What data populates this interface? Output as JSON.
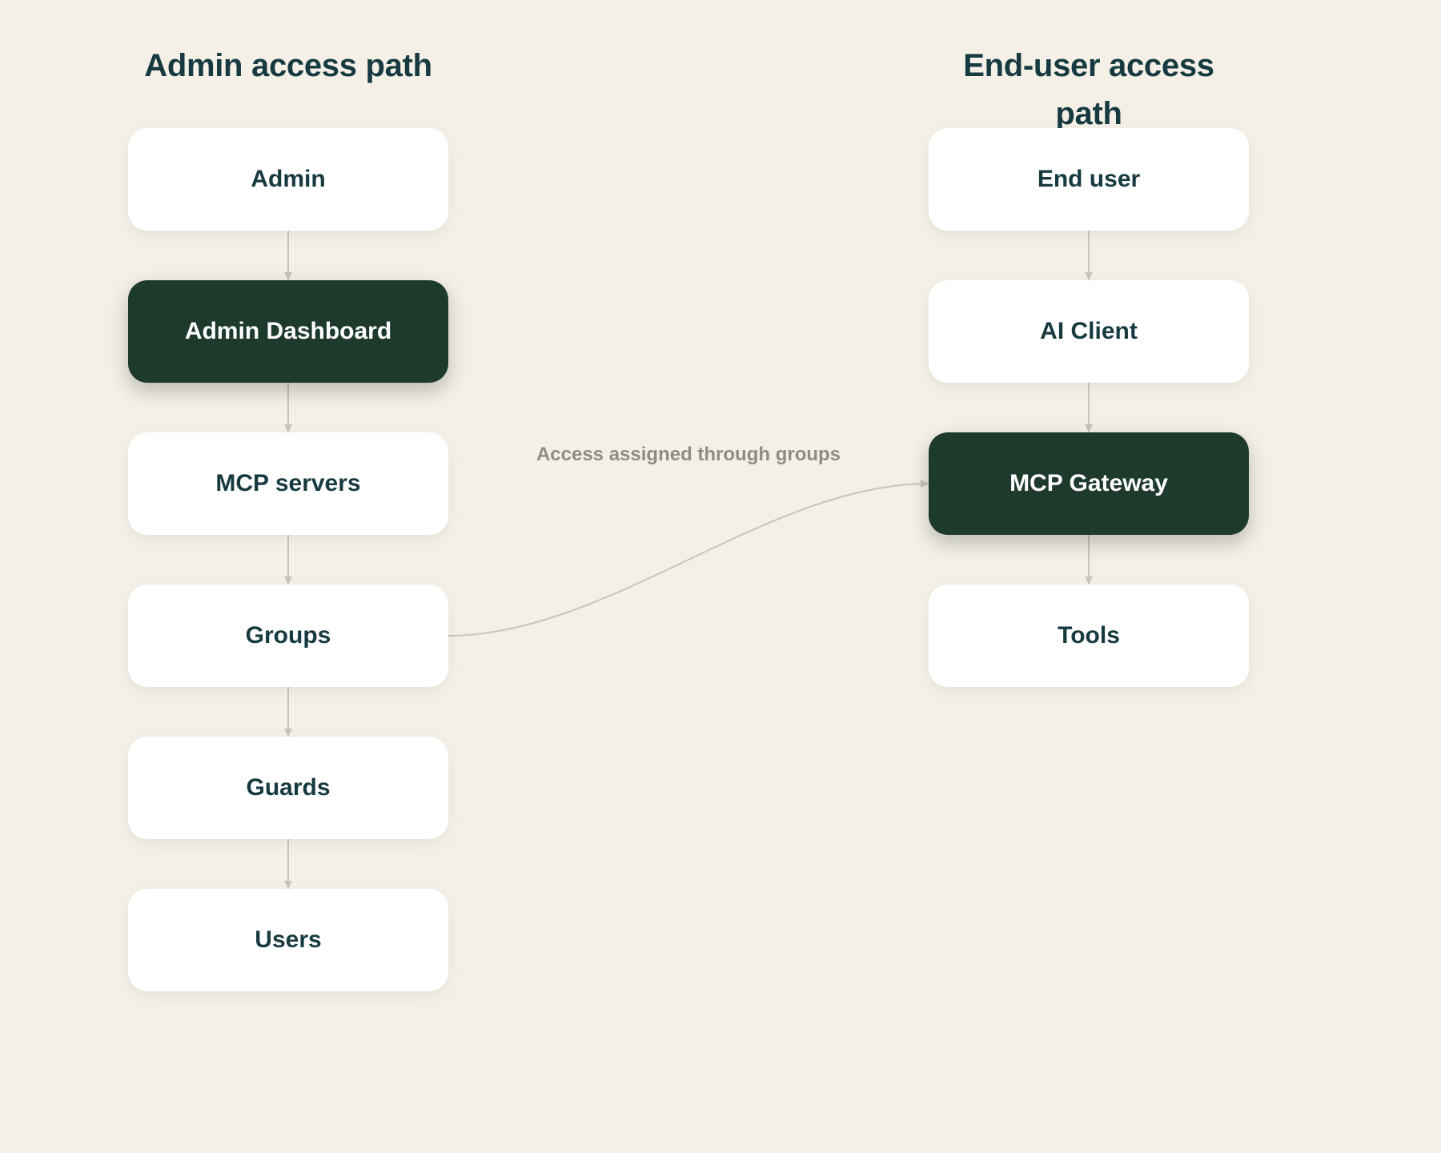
{
  "titles": {
    "left": "Admin access path",
    "right": "End-user access path"
  },
  "admin_path": {
    "admin": "Admin",
    "dashboard": "Admin Dashboard",
    "mcp_servers": "MCP servers",
    "groups": "Groups",
    "guards": "Guards",
    "users": "Users"
  },
  "user_path": {
    "end_user": "End user",
    "ai_client": "AI Client",
    "gateway": "MCP Gateway",
    "tools": "Tools"
  },
  "edge_label": "Access assigned through groups",
  "colors": {
    "background": "#f4f0e8",
    "node": "#ffffff",
    "node_highlight": "#1e3a2c",
    "text": "#163a40",
    "connector": "#c8c4b8",
    "edge_label": "#8d8d86"
  }
}
